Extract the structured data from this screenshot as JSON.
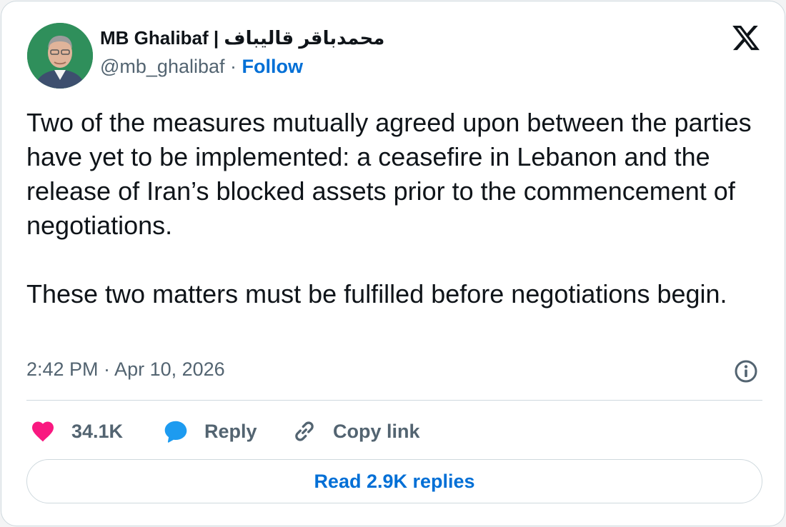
{
  "author": {
    "display_name": "MB Ghalibaf | محمدباقر قالیباف",
    "handle": "@mb_ghalibaf",
    "separator": " · ",
    "follow_label": "Follow"
  },
  "tweet": {
    "text": "Two of the measures mutually agreed upon between the parties have yet to be implemented: a ceasefire in Lebanon and the release of Iran’s blocked assets prior to the commencement of negotiations.\n\nThese two matters must be fulfilled before negotiations begin.",
    "timestamp": "2:42 PM · Apr 10, 2026"
  },
  "actions": {
    "like_count": "34.1K",
    "reply_label": "Reply",
    "copy_link_label": "Copy link"
  },
  "read_replies_label": "Read 2.9K replies",
  "icons": {
    "platform": "x-logo-icon",
    "info": "info-icon",
    "like": "heart-icon",
    "reply": "speech-bubble-icon",
    "copy": "link-icon"
  },
  "colors": {
    "like": "#f91880",
    "reply": "#1d9bf0",
    "link": "#006fd6",
    "muted": "#536471",
    "text": "#0f1419",
    "border": "#cfd9de"
  }
}
